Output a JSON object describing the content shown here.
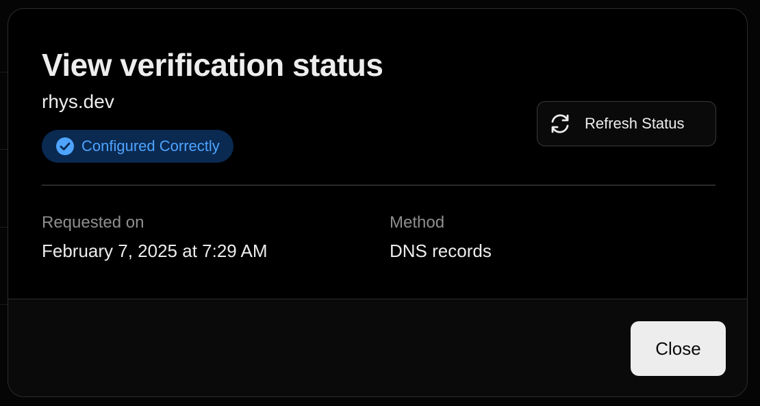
{
  "dialog": {
    "title": "View verification status",
    "domain": "rhys.dev",
    "status_badge": {
      "label": "Configured Correctly",
      "icon": "check-circle-icon",
      "text_color": "#4ea4ff",
      "background": "#0a2a52"
    },
    "refresh_button": {
      "label": "Refresh Status",
      "icon": "refresh-icon"
    },
    "details": {
      "requested_on": {
        "label": "Requested on",
        "value": "February 7, 2025 at 7:29 AM"
      },
      "method": {
        "label": "Method",
        "value": "DNS records"
      }
    },
    "close_button": {
      "label": "Close"
    }
  }
}
